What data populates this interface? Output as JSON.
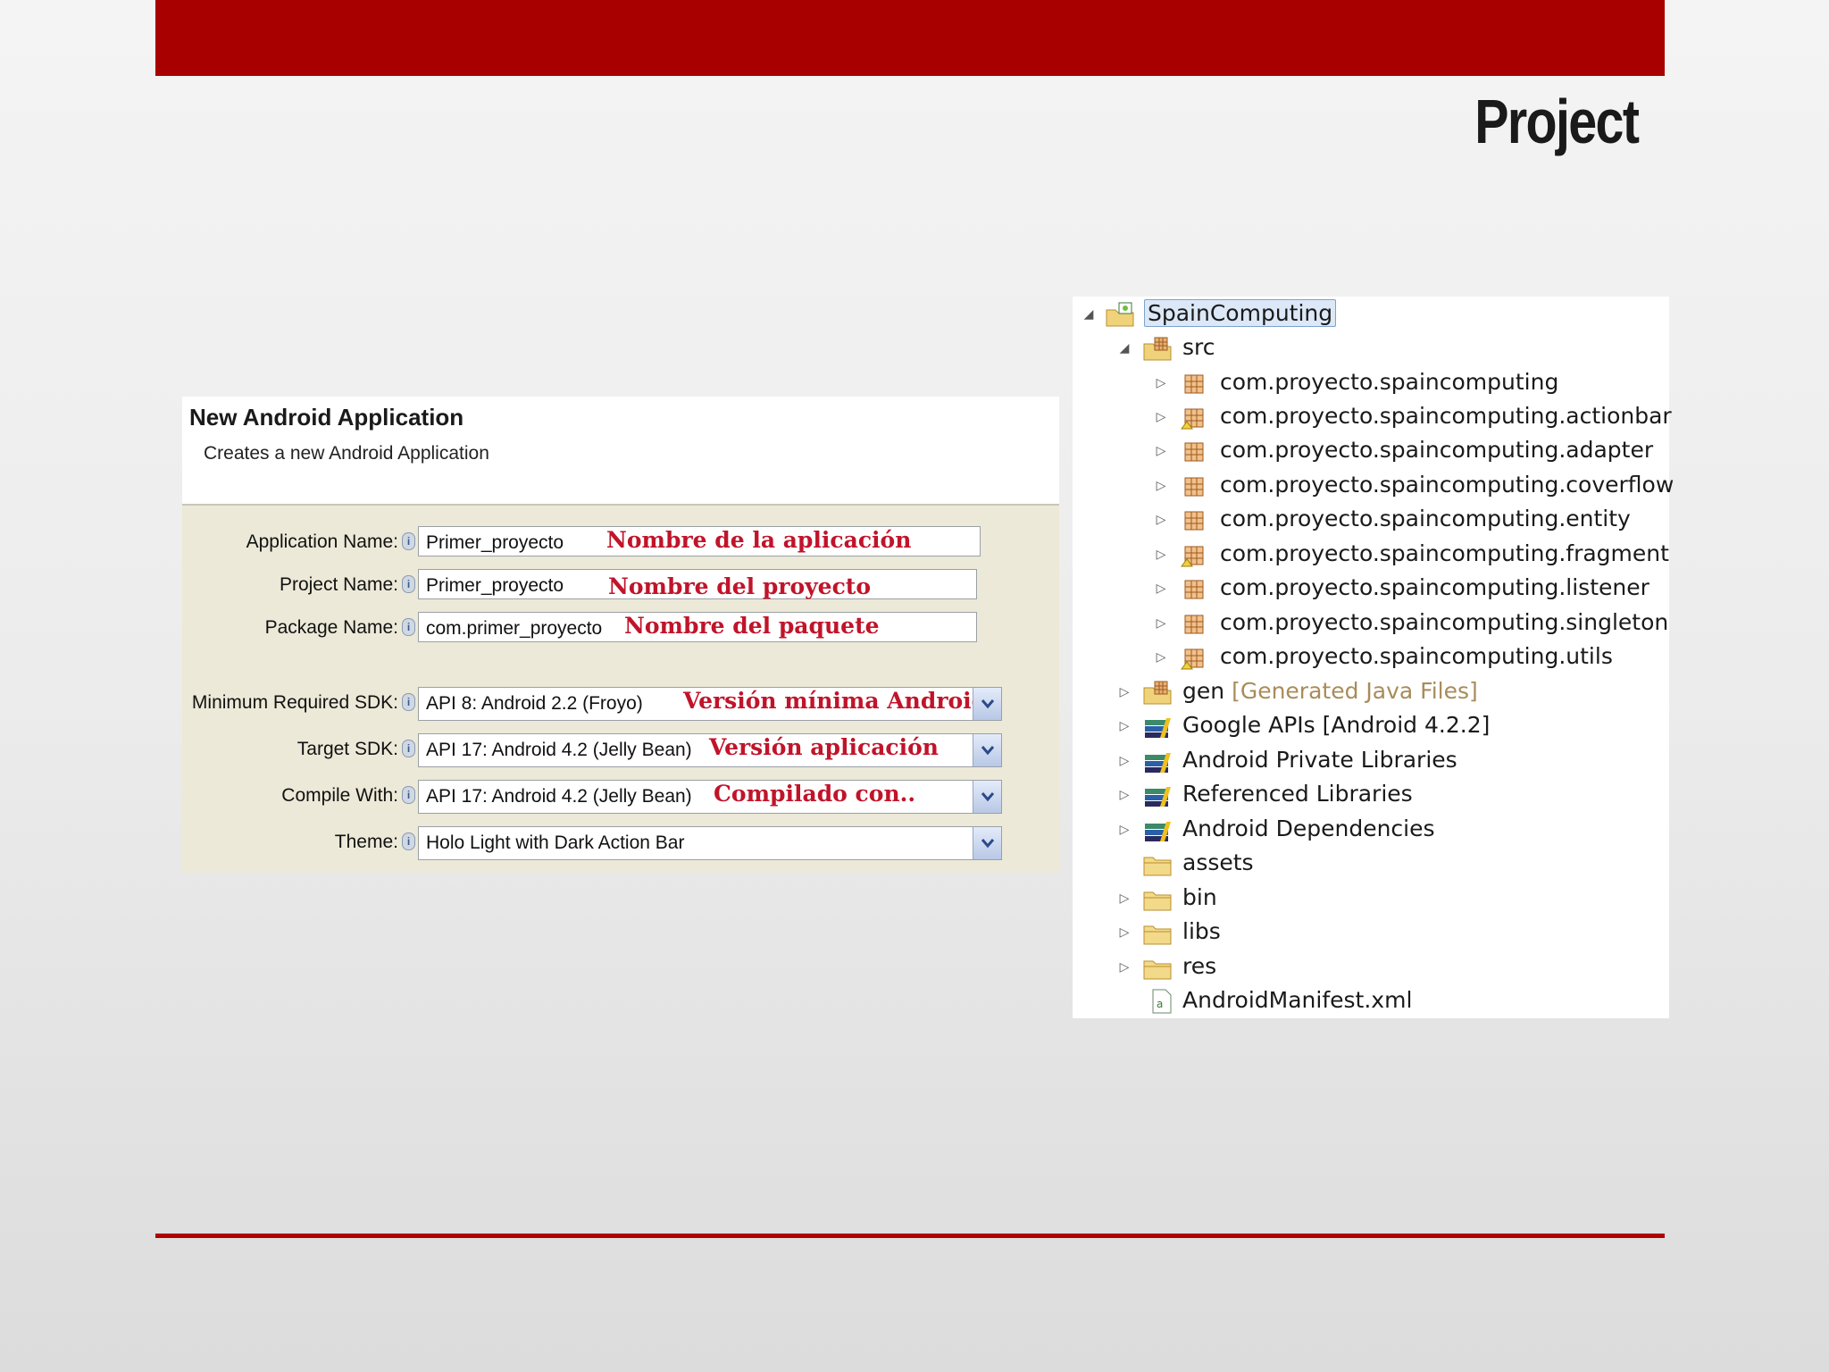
{
  "slide": {
    "title": "Project"
  },
  "wizard": {
    "title": "New Android Application",
    "subtitle": "Creates a new Android Application",
    "fields": [
      {
        "label": "Application Name:",
        "value": "Primer_proyecto",
        "annotation": "Nombre de la aplicación"
      },
      {
        "label": "Project Name:",
        "value": "Primer_proyecto",
        "annotation": "Nombre del proyecto"
      },
      {
        "label": "Package Name:",
        "value": "com.primer_proyecto",
        "annotation": "Nombre del paquete"
      }
    ],
    "selects": [
      {
        "label": "Minimum Required SDK:",
        "value": "API 8: Android 2.2 (Froyo)",
        "annotation": "Versión mínima Android"
      },
      {
        "label": "Target SDK:",
        "value": "API 17: Android 4.2 (Jelly Bean)",
        "annotation": "Versión aplicación"
      },
      {
        "label": "Compile With:",
        "value": "API 17: Android 4.2 (Jelly Bean)",
        "annotation": "Compilado con.."
      },
      {
        "label": "Theme:",
        "value": "Holo Light with Dark Action Bar",
        "annotation": ""
      }
    ]
  },
  "tree": {
    "project": "SpainComputing",
    "src": "src",
    "packages": [
      "com.proyecto.spaincomputing",
      "com.proyecto.spaincomputing.actionbar",
      "com.proyecto.spaincomputing.adapter",
      "com.proyecto.spaincomputing.coverflow",
      "com.proyecto.spaincomputing.entity",
      "com.proyecto.spaincomputing.fragment",
      "com.proyecto.spaincomputing.listener",
      "com.proyecto.spaincomputing.singleton",
      "com.proyecto.spaincomputing.utils"
    ],
    "gen": "gen",
    "gen_hint": "[Generated Java Files]",
    "libraries": [
      "Google APIs [Android 4.2.2]",
      "Android Private Libraries",
      "Referenced Libraries",
      "Android Dependencies"
    ],
    "folders": [
      "assets",
      "bin",
      "libs",
      "res"
    ],
    "manifest": "AndroidManifest.xml"
  },
  "colors": {
    "accent": "#a80000",
    "annotation": "#c0142a"
  }
}
